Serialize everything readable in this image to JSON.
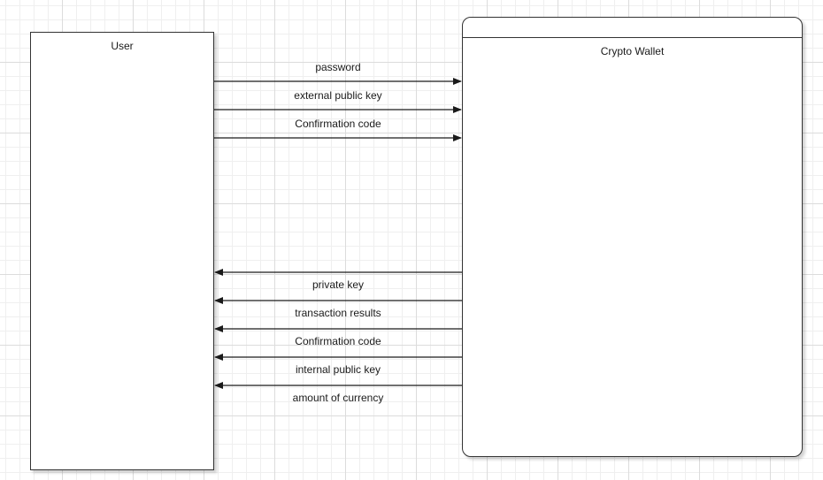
{
  "entities": {
    "user": {
      "label": "User"
    },
    "wallet": {
      "label": "Crypto Wallet"
    }
  },
  "flows_to_wallet": [
    {
      "label": "password"
    },
    {
      "label": "external public key"
    },
    {
      "label": "Confirmation code"
    }
  ],
  "flows_to_user": [
    {
      "label": "private key"
    },
    {
      "label": "transaction results"
    },
    {
      "label": "Confirmation code"
    },
    {
      "label": "internal public key"
    },
    {
      "label": "amount of currency"
    }
  ],
  "colors": {
    "line": "#1a1a1a",
    "grid": "#dcdcdc",
    "border": "#333333"
  }
}
